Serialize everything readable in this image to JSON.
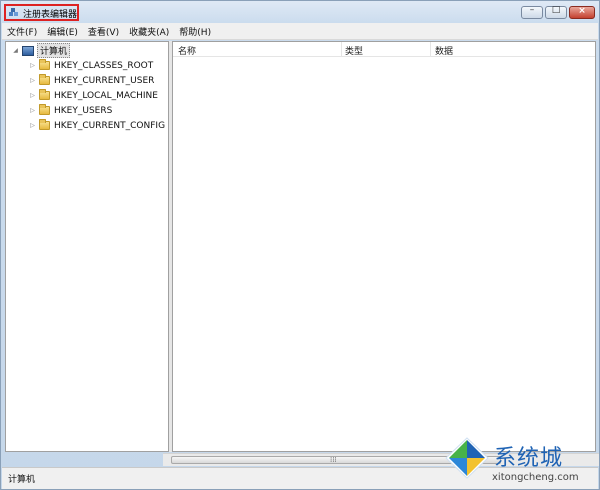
{
  "window": {
    "title": "注册表编辑器"
  },
  "menu": [
    {
      "label": "文件(F)"
    },
    {
      "label": "编辑(E)"
    },
    {
      "label": "查看(V)"
    },
    {
      "label": "收藏夹(A)"
    },
    {
      "label": "帮助(H)"
    }
  ],
  "tree": {
    "root": "计算机",
    "items": [
      {
        "label": "HKEY_CLASSES_ROOT"
      },
      {
        "label": "HKEY_CURRENT_USER"
      },
      {
        "label": "HKEY_LOCAL_MACHINE"
      },
      {
        "label": "HKEY_USERS"
      },
      {
        "label": "HKEY_CURRENT_CONFIG"
      }
    ]
  },
  "list": {
    "columns": [
      "名称",
      "类型",
      "数据"
    ]
  },
  "status": {
    "text": "计算机"
  },
  "watermark": {
    "name": "系统城",
    "url": "xitongcheng.com"
  },
  "colors": {
    "accent": "#1f63b4",
    "highlight": "#dd2222",
    "logo_green": "#47b249"
  }
}
